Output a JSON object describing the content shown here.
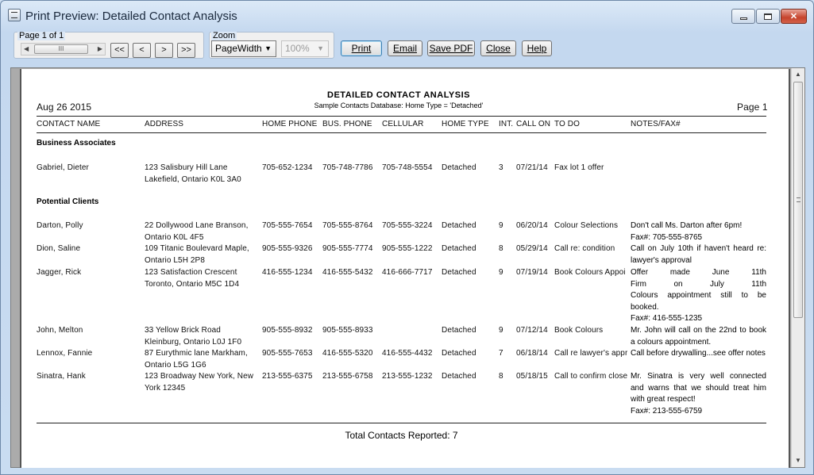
{
  "window": {
    "title": "Print Preview: Detailed Contact Analysis"
  },
  "toolbar": {
    "page_group_label": "Page 1 of 1",
    "scroll_thumb": "III",
    "nav": {
      "first": "<<",
      "prev": "<",
      "next": ">",
      "last": ">>"
    },
    "zoom_group_label": "Zoom",
    "zoom_mode": "PageWidth",
    "zoom_percent": "100%",
    "buttons": {
      "print": "Print",
      "email": "Email",
      "save_pdf": "Save PDF",
      "close": "Close",
      "help": "Help"
    }
  },
  "report": {
    "title": "DETAILED CONTACT ANALYSIS",
    "subtitle": "Sample Contacts Database: Home Type = 'Detached'",
    "date": "Aug 26 2015",
    "page": "Page 1",
    "columns": [
      "CONTACT NAME",
      "ADDRESS",
      "HOME PHONE",
      "BUS. PHONE",
      "CELLULAR",
      "HOME TYPE",
      "INT.",
      "CALL ON",
      "TO DO",
      "NOTES/FAX#"
    ],
    "sections": [
      {
        "name": "Business Associates",
        "rows": [
          {
            "name": "Gabriel, Dieter",
            "address": [
              "123 Salisbury Hill Lane",
              "Lakefield, Ontario K0L 3A0"
            ],
            "home_phone": "705-652-1234",
            "bus_phone": "705-748-7786",
            "cellular": "705-748-5554",
            "home_type": "Detached",
            "interest": "3",
            "call_on": "07/21/14",
            "to_do": "Fax lot 1 offer",
            "notes": []
          }
        ]
      },
      {
        "name": "Potential Clients",
        "rows": [
          {
            "name": "Darton, Polly",
            "address": [
              "22 Dollywood Lane Branson,",
              "Ontario K0L 4F5"
            ],
            "home_phone": "705-555-7654",
            "bus_phone": "705-555-8764",
            "cellular": "705-555-3224",
            "home_type": "Detached",
            "interest": "9",
            "call_on": "06/20/14",
            "to_do": "Colour Selections",
            "notes": [
              "Don't call Ms. Darton after 6pm!",
              "Fax#: 705-555-8765"
            ]
          },
          {
            "name": "Dion, Saline",
            "address": [
              "109 Titanic Boulevard Maple,",
              "Ontario L5H 2P8"
            ],
            "home_phone": "905-555-9326",
            "bus_phone": "905-555-7774",
            "cellular": "905-555-1222",
            "home_type": "Detached",
            "interest": "8",
            "call_on": "05/29/14",
            "to_do": "Call re: condition",
            "notes": [
              "Call on July 10th if haven't heard re:",
              "lawyer's approval"
            ]
          },
          {
            "name": "Jagger, Rick",
            "address": [
              "123 Satisfaction Crescent",
              "Toronto, Ontario M5C 1D4"
            ],
            "home_phone": "416-555-1234",
            "bus_phone": "416-555-5432",
            "cellular": "416-666-7717",
            "home_type": "Detached",
            "interest": "9",
            "call_on": "07/19/14",
            "to_do": "Book Colours Appoi",
            "notes": [
              "Offer made June 11th",
              "Firm on July 11th",
              "Colours appointment still to be",
              "booked.",
              "Fax#: 416-555-1235"
            ]
          },
          {
            "name": "John, Melton",
            "address": [
              "33 Yellow Brick Road",
              "Kleinburg, Ontario L0J 1F0"
            ],
            "home_phone": "905-555-8932",
            "bus_phone": "905-555-8933",
            "cellular": "",
            "home_type": "Detached",
            "interest": "9",
            "call_on": "07/12/14",
            "to_do": "Book Colours",
            "notes": [
              "Mr. John will call on the 22nd to book",
              "a colours appointment."
            ]
          },
          {
            "name": "Lennox, Fannie",
            "address": [
              "87 Eurythmic lane Markham,",
              "Ontario L5G 1G6"
            ],
            "home_phone": "905-555-7653",
            "bus_phone": "416-555-5320",
            "cellular": "416-555-4432",
            "home_type": "Detached",
            "interest": "7",
            "call_on": "06/18/14",
            "to_do": "Call re lawyer's appr",
            "notes": [
              "Call before drywalling...see offer notes"
            ]
          },
          {
            "name": "Sinatra, Hank",
            "address": [
              "123 Broadway New York, New",
              "York 12345"
            ],
            "home_phone": "213-555-6375",
            "bus_phone": "213-555-6758",
            "cellular": "213-555-1232",
            "home_type": "Detached",
            "interest": "8",
            "call_on": "05/18/15",
            "to_do": "Call to confirm close",
            "notes": [
              "Mr. Sinatra is very well connected",
              "and warns that we should treat him",
              "with great respect!",
              "Fax#: 213-555-6759"
            ]
          }
        ]
      }
    ],
    "total": "Total Contacts Reported: 7"
  }
}
